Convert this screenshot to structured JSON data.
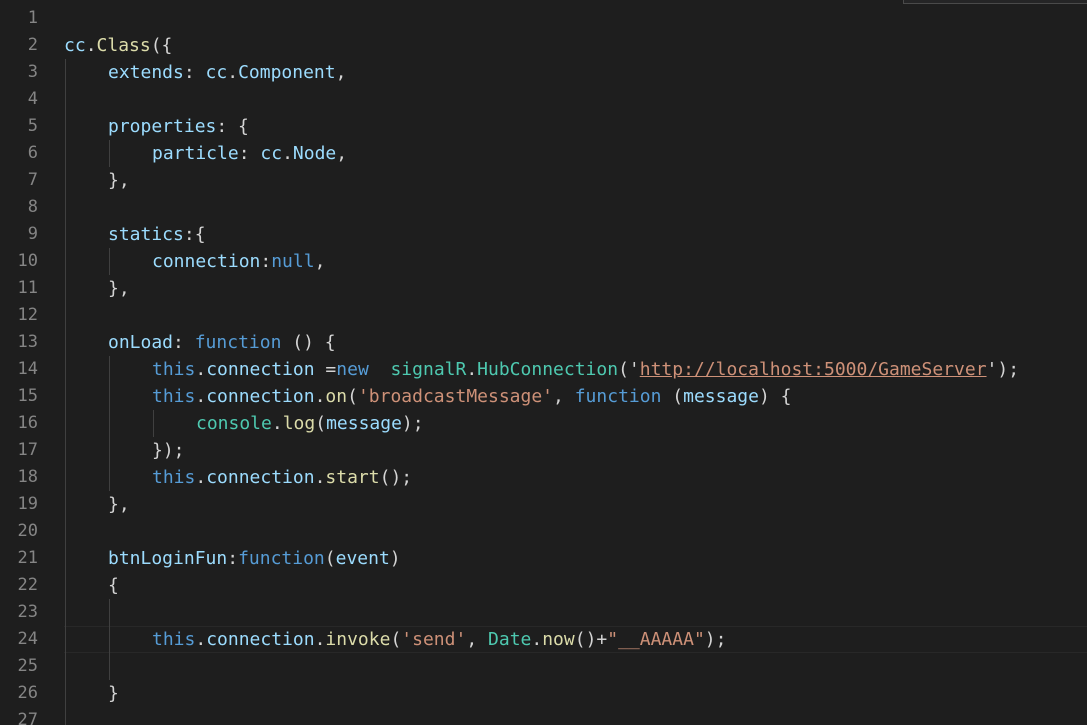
{
  "editor": {
    "line_numbers": [
      "1",
      "2",
      "3",
      "4",
      "5",
      "6",
      "7",
      "8",
      "9",
      "10",
      "11",
      "12",
      "13",
      "14",
      "15",
      "16",
      "17",
      "18",
      "19",
      "20",
      "21",
      "22",
      "23",
      "24",
      "25",
      "26",
      "27"
    ],
    "current_line": 24,
    "colors": {
      "background": "#1e1e1e",
      "default": "#d4d4d4",
      "variable": "#9cdcfe",
      "keyword": "#569cd6",
      "type": "#4ec9b0",
      "function": "#dcdcaa",
      "string": "#ce9178",
      "line_number": "#858585"
    },
    "lines": [
      {
        "line": 1,
        "indent": 0,
        "tokens": []
      },
      {
        "line": 2,
        "indent": 0,
        "tokens": [
          {
            "t": "cc",
            "c": "variable"
          },
          {
            "t": ".",
            "c": "default"
          },
          {
            "t": "Class",
            "c": "function"
          },
          {
            "t": "({",
            "c": "default"
          }
        ]
      },
      {
        "line": 3,
        "indent": 1,
        "tokens": [
          {
            "t": "extends",
            "c": "variable"
          },
          {
            "t": ": ",
            "c": "default"
          },
          {
            "t": "cc",
            "c": "variable"
          },
          {
            "t": ".",
            "c": "default"
          },
          {
            "t": "Component",
            "c": "variable"
          },
          {
            "t": ",",
            "c": "default"
          }
        ]
      },
      {
        "line": 4,
        "indent": 0,
        "tokens": []
      },
      {
        "line": 5,
        "indent": 1,
        "tokens": [
          {
            "t": "properties",
            "c": "variable"
          },
          {
            "t": ": {",
            "c": "default"
          }
        ]
      },
      {
        "line": 6,
        "indent": 2,
        "tokens": [
          {
            "t": "particle",
            "c": "variable"
          },
          {
            "t": ": ",
            "c": "default"
          },
          {
            "t": "cc",
            "c": "variable"
          },
          {
            "t": ".",
            "c": "default"
          },
          {
            "t": "Node",
            "c": "variable"
          },
          {
            "t": ",",
            "c": "default"
          }
        ]
      },
      {
        "line": 7,
        "indent": 1,
        "tokens": [
          {
            "t": "},",
            "c": "default"
          }
        ]
      },
      {
        "line": 8,
        "indent": 0,
        "tokens": []
      },
      {
        "line": 9,
        "indent": 1,
        "tokens": [
          {
            "t": "statics",
            "c": "variable"
          },
          {
            "t": ":{",
            "c": "default"
          }
        ]
      },
      {
        "line": 10,
        "indent": 2,
        "tokens": [
          {
            "t": "connection",
            "c": "variable"
          },
          {
            "t": ":",
            "c": "default"
          },
          {
            "t": "null",
            "c": "keyword"
          },
          {
            "t": ",",
            "c": "default"
          }
        ]
      },
      {
        "line": 11,
        "indent": 1,
        "tokens": [
          {
            "t": "},",
            "c": "default"
          }
        ]
      },
      {
        "line": 12,
        "indent": 0,
        "tokens": []
      },
      {
        "line": 13,
        "indent": 1,
        "tokens": [
          {
            "t": "onLoad",
            "c": "variable"
          },
          {
            "t": ": ",
            "c": "default"
          },
          {
            "t": "function",
            "c": "keyword"
          },
          {
            "t": " () {",
            "c": "default"
          }
        ]
      },
      {
        "line": 14,
        "indent": 2,
        "tokens": [
          {
            "t": "this",
            "c": "keyword"
          },
          {
            "t": ".",
            "c": "default"
          },
          {
            "t": "connection",
            "c": "variable"
          },
          {
            "t": " =",
            "c": "default"
          },
          {
            "t": "new",
            "c": "keyword"
          },
          {
            "t": "  ",
            "c": "default"
          },
          {
            "t": "signalR",
            "c": "type"
          },
          {
            "t": ".",
            "c": "default"
          },
          {
            "t": "HubConnection",
            "c": "type"
          },
          {
            "t": "('",
            "c": "default"
          },
          {
            "t": "http://localhost:5000/GameServer",
            "c": "string",
            "u": true
          },
          {
            "t": "');",
            "c": "default"
          }
        ]
      },
      {
        "line": 15,
        "indent": 2,
        "tokens": [
          {
            "t": "this",
            "c": "keyword"
          },
          {
            "t": ".",
            "c": "default"
          },
          {
            "t": "connection",
            "c": "variable"
          },
          {
            "t": ".",
            "c": "default"
          },
          {
            "t": "on",
            "c": "function"
          },
          {
            "t": "(",
            "c": "default"
          },
          {
            "t": "'broadcastMessage'",
            "c": "string"
          },
          {
            "t": ", ",
            "c": "default"
          },
          {
            "t": "function",
            "c": "keyword"
          },
          {
            "t": " (",
            "c": "default"
          },
          {
            "t": "message",
            "c": "variable"
          },
          {
            "t": ") {",
            "c": "default"
          }
        ]
      },
      {
        "line": 16,
        "indent": 3,
        "tokens": [
          {
            "t": "console",
            "c": "type"
          },
          {
            "t": ".",
            "c": "default"
          },
          {
            "t": "log",
            "c": "function"
          },
          {
            "t": "(",
            "c": "default"
          },
          {
            "t": "message",
            "c": "variable"
          },
          {
            "t": ");",
            "c": "default"
          }
        ]
      },
      {
        "line": 17,
        "indent": 2,
        "tokens": [
          {
            "t": "});",
            "c": "default"
          }
        ]
      },
      {
        "line": 18,
        "indent": 2,
        "tokens": [
          {
            "t": "this",
            "c": "keyword"
          },
          {
            "t": ".",
            "c": "default"
          },
          {
            "t": "connection",
            "c": "variable"
          },
          {
            "t": ".",
            "c": "default"
          },
          {
            "t": "start",
            "c": "function"
          },
          {
            "t": "();",
            "c": "default"
          }
        ]
      },
      {
        "line": 19,
        "indent": 1,
        "tokens": [
          {
            "t": "},",
            "c": "default"
          }
        ]
      },
      {
        "line": 20,
        "indent": 0,
        "tokens": []
      },
      {
        "line": 21,
        "indent": 1,
        "tokens": [
          {
            "t": "btnLoginFun",
            "c": "variable"
          },
          {
            "t": ":",
            "c": "default"
          },
          {
            "t": "function",
            "c": "keyword"
          },
          {
            "t": "(",
            "c": "default"
          },
          {
            "t": "event",
            "c": "variable"
          },
          {
            "t": ")",
            "c": "default"
          }
        ]
      },
      {
        "line": 22,
        "indent": 1,
        "tokens": [
          {
            "t": "{",
            "c": "default"
          }
        ]
      },
      {
        "line": 23,
        "indent": 0,
        "tokens": []
      },
      {
        "line": 24,
        "indent": 2,
        "tokens": [
          {
            "t": "this",
            "c": "keyword"
          },
          {
            "t": ".",
            "c": "default"
          },
          {
            "t": "connection",
            "c": "variable"
          },
          {
            "t": ".",
            "c": "default"
          },
          {
            "t": "invoke",
            "c": "function"
          },
          {
            "t": "(",
            "c": "default"
          },
          {
            "t": "'send'",
            "c": "string"
          },
          {
            "t": ", ",
            "c": "default"
          },
          {
            "t": "Date",
            "c": "type"
          },
          {
            "t": ".",
            "c": "default"
          },
          {
            "t": "now",
            "c": "function"
          },
          {
            "t": "()+",
            "c": "default"
          },
          {
            "t": "\"__AAAAA\"",
            "c": "string"
          },
          {
            "t": ");",
            "c": "default"
          }
        ]
      },
      {
        "line": 25,
        "indent": 0,
        "tokens": []
      },
      {
        "line": 26,
        "indent": 1,
        "tokens": [
          {
            "t": "}",
            "c": "default"
          }
        ]
      },
      {
        "line": 27,
        "indent": 0,
        "tokens": []
      }
    ]
  }
}
